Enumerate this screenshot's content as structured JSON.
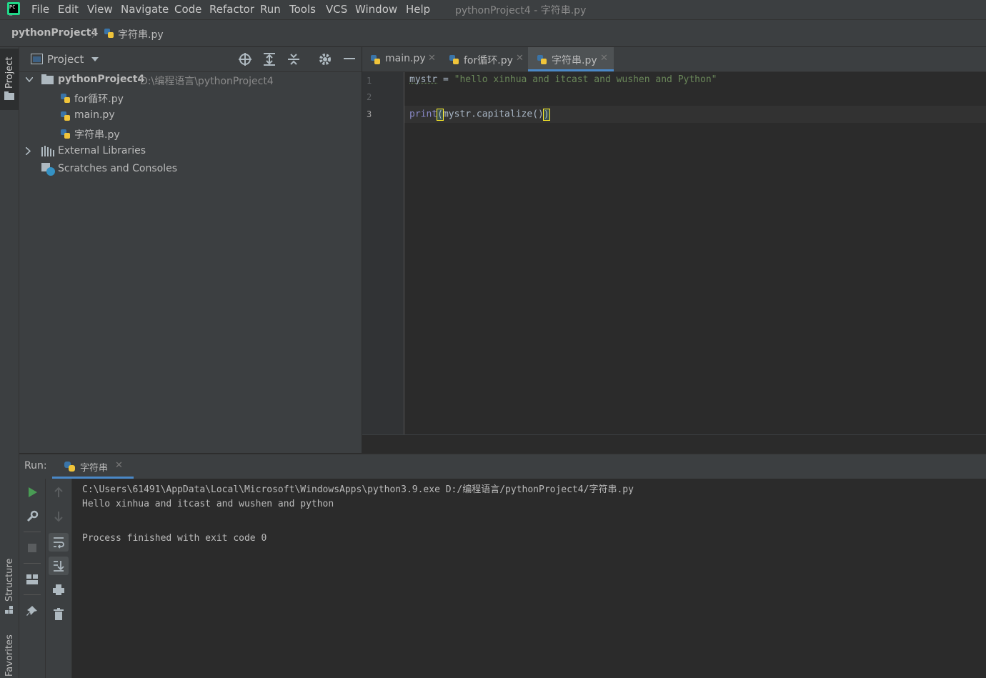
{
  "menubar": {
    "items": [
      "File",
      "Edit",
      "View",
      "Navigate",
      "Code",
      "Refactor",
      "Run",
      "Tools",
      "VCS",
      "Window",
      "Help"
    ],
    "window_title": "pythonProject4 - 字符串.py"
  },
  "navbar": {
    "project": "pythonProject4",
    "file": "字符串.py"
  },
  "left_strip": {
    "project_label": "Project",
    "structure_label": "Structure",
    "favorites_label": "Favorites"
  },
  "project_panel": {
    "title": "Project",
    "root": {
      "name": "pythonProject4",
      "path": "D:\\编程语言\\pythonProject4"
    },
    "files": [
      "for循环.py",
      "main.py",
      "字符串.py"
    ],
    "external": "External Libraries",
    "scratches": "Scratches and Consoles"
  },
  "editor": {
    "tabs": [
      {
        "label": "main.py",
        "active": false
      },
      {
        "label": "for循环.py",
        "active": false
      },
      {
        "label": "字符串.py",
        "active": true
      }
    ],
    "line_numbers": [
      "1",
      "2",
      "3"
    ],
    "line1": {
      "var": "mystr",
      "op": " = ",
      "str": "\"hello xinhua and itcast and wushen and Python\""
    },
    "line3": {
      "func": "print",
      "open": "(",
      "body": "mystr.capitalize()",
      "close": ")"
    }
  },
  "run_panel": {
    "label": "Run:",
    "tab": "字符串",
    "output": [
      "C:\\Users\\61491\\AppData\\Local\\Microsoft\\WindowsApps\\python3.9.exe D:/编程语言/pythonProject4/字符串.py",
      "Hello xinhua and itcast and wushen and python",
      "",
      "Process finished with exit code 0"
    ]
  },
  "colors": {
    "accent": "#4a88c7",
    "keyword": "#8888c6",
    "string": "#6a8759",
    "run_green": "#499c54"
  }
}
